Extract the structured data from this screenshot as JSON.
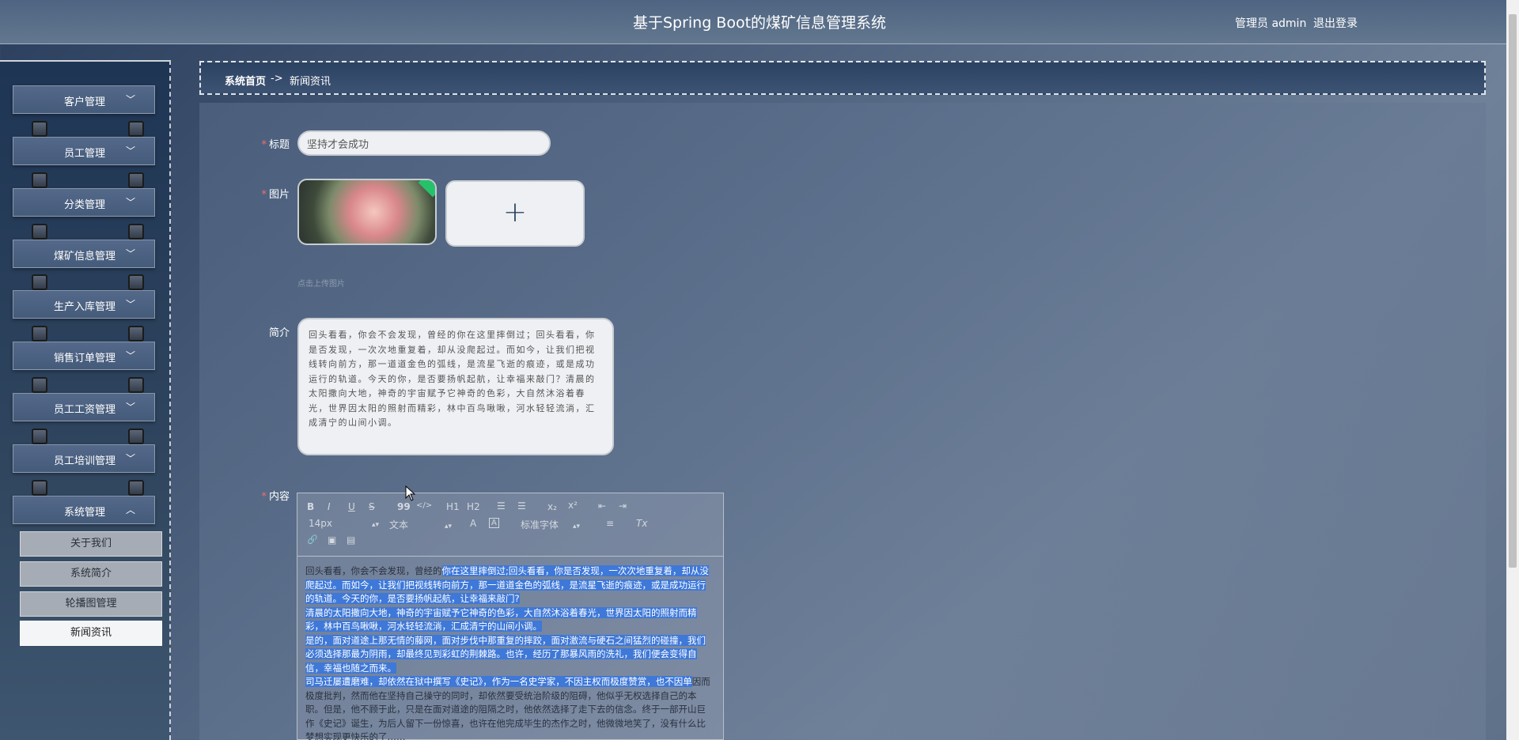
{
  "header": {
    "title": "基于Spring Boot的煤矿信息管理系统",
    "user_label": "管理员 admin",
    "logout_label": "退出登录"
  },
  "sidebar": {
    "items": [
      {
        "label": "客户管理",
        "expanded": false
      },
      {
        "label": "员工管理",
        "expanded": false
      },
      {
        "label": "分类管理",
        "expanded": false
      },
      {
        "label": "煤矿信息管理",
        "expanded": false
      },
      {
        "label": "生产入库管理",
        "expanded": false
      },
      {
        "label": "销售订单管理",
        "expanded": false
      },
      {
        "label": "员工工资管理",
        "expanded": false
      },
      {
        "label": "员工培训管理",
        "expanded": false
      },
      {
        "label": "系统管理",
        "expanded": true
      }
    ],
    "chevron_down": "﹀",
    "chevron_up": "︿",
    "sub_items": [
      {
        "label": "关于我们",
        "active": false
      },
      {
        "label": "系统简介",
        "active": false
      },
      {
        "label": "轮播图管理",
        "active": false
      },
      {
        "label": "新闻资讯",
        "active": true
      }
    ]
  },
  "breadcrumb": {
    "home": "系统首页",
    "separator": "->",
    "current": "新闻资讯"
  },
  "form": {
    "required_mark": "*",
    "title_label": "标题",
    "title_value": "坚持才会成功",
    "image_label": "图片",
    "upload_plus": "+",
    "upload_hint": "点击上传图片",
    "intro_label": "简介",
    "intro_value": "回头看看，你会不会发现，曾经的你在这里摔倒过；回头看看，你是否发现，一次次地重复着，却从没爬起过。而如今，让我们把视线转向前方，那一道道金色的弧线，是流星飞逝的痕迹，或是成功运行的轨道。今天的你，是否要扬帆起航，让幸福来敲门？清晨的太阳撒向大地，神奇的宇宙赋予它神奇的色彩，大自然沐浴着春光，世界因太阳的照射而精彩，林中百鸟啾啾，河水轻轻流淌，汇成清宁的山间小调。",
    "content_label": "内容"
  },
  "editor": {
    "toolbar": {
      "bold": "B",
      "italic": "I",
      "underline": "U",
      "strike": "S",
      "quote": "99",
      "code": "</>",
      "h1": "H1",
      "h2": "H2",
      "ordered_list": "☰",
      "bullet_list": "☰",
      "subscript": "x₂",
      "superscript": "x²",
      "outdent": "⇤",
      "indent": "⇥",
      "size_select": "14px",
      "type_select": "文本",
      "font_color": "A",
      "bg_color": "A",
      "font_select": "标准字体",
      "align": "≡",
      "clean": "Tx",
      "link": "🔗",
      "image": "▣",
      "video": "▤"
    },
    "paragraphs": [
      {
        "plain": "回头看看，你会不会发现，曾经的",
        "selected": "你在这里摔倒过;回头看看，你是否发现，一次次地重复着，却从没爬起过。而如今，让我们把视线转向前方，那一道道金色的弧线，是流星飞逝的痕迹，或是成功运行的轨道。今天的你，是否要扬帆起航，让幸福来敲门?"
      },
      {
        "plain": "",
        "selected": "清晨的太阳撒向大地，神奇的宇宙赋予它神奇的色彩，大自然沐浴着春光，世界因太阳的照射而精彩，林中百鸟啾啾，河水轻轻流淌，汇成清宁的山间小调。"
      },
      {
        "plain": "",
        "selected": "是的，面对道途上那无情的藤网，面对步伐中那重复的摔跤，面对激流与硬石之间猛烈的碰撞，我们必须选择那最为阴雨，却最终见到彩虹的荆棘路。也许，经历了那暴风雨的洗礼，我们便会变得自信，幸福也随之而来。"
      },
      {
        "plain": "因而极度批判，然而他在坚持自己操守的同时，却依然要受统治阶级的阻碍，他似乎无权选择自己的本职。但是，他不顾于此，只是在面对道途的阻隔之时，他依然选择了走下去的信念。终于一部开山巨作《史记》诞生，为后人留下一份惊喜，也许在他完成毕生的杰作之时，他微微地笑了，没有什么比梦想实现更快乐的了……",
        "selected": "司马迁屡遭磨难，却依然在狱中撰写《史记》，作为一名史学家，不因主权而极度赞赏，也不因单"
      }
    ]
  }
}
